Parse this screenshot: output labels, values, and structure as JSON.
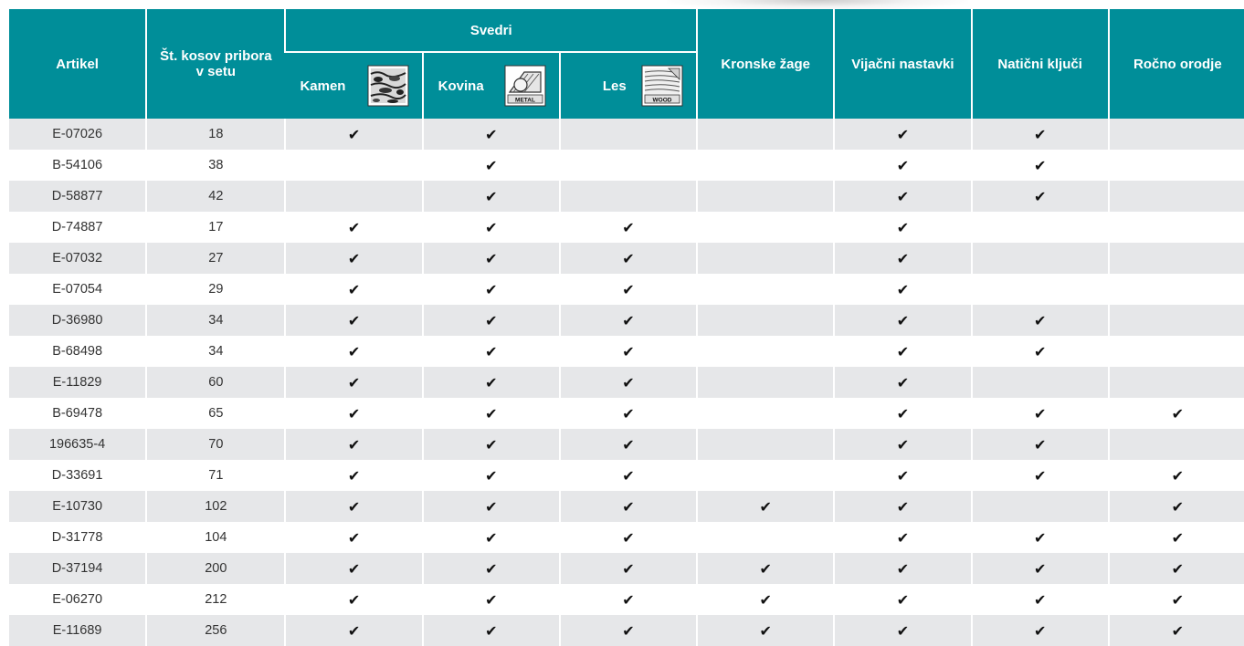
{
  "header": {
    "artikel": "Artikel",
    "pieces": "Št. kosov pribora v setu",
    "drills_group": "Svedri",
    "kamen": "Kamen",
    "kovina": "Kovina",
    "les": "Les",
    "kronske": "Kronske žage",
    "vijacni": "Vijačni nastavki",
    "naticni": "Natični ključi",
    "rocno": "Ročno orodje"
  },
  "icons": {
    "kamen": "stone-material-icon",
    "kovina": "metal-material-icon",
    "les": "wood-material-icon",
    "kovina_text": "METAL",
    "les_text": "WOOD"
  },
  "check_symbol": "✔",
  "colors": {
    "header_bg": "#008e99",
    "row_alt": "#e6e7e9",
    "header_text": "#ffffff"
  },
  "rows": [
    {
      "artikel": "E-07026",
      "pieces": "18",
      "checks": [
        1,
        1,
        0,
        0,
        1,
        1,
        0
      ]
    },
    {
      "artikel": "B-54106",
      "pieces": "38",
      "checks": [
        0,
        1,
        0,
        0,
        1,
        1,
        0
      ]
    },
    {
      "artikel": "D-58877",
      "pieces": "42",
      "checks": [
        0,
        1,
        0,
        0,
        1,
        1,
        0
      ]
    },
    {
      "artikel": "D-74887",
      "pieces": "17",
      "checks": [
        1,
        1,
        1,
        0,
        1,
        0,
        0
      ]
    },
    {
      "artikel": "E-07032",
      "pieces": "27",
      "checks": [
        1,
        1,
        1,
        0,
        1,
        0,
        0
      ]
    },
    {
      "artikel": "E-07054",
      "pieces": "29",
      "checks": [
        1,
        1,
        1,
        0,
        1,
        0,
        0
      ]
    },
    {
      "artikel": "D-36980",
      "pieces": "34",
      "checks": [
        1,
        1,
        1,
        0,
        1,
        1,
        0
      ]
    },
    {
      "artikel": "B-68498",
      "pieces": "34",
      "checks": [
        1,
        1,
        1,
        0,
        1,
        1,
        0
      ]
    },
    {
      "artikel": "E-11829",
      "pieces": "60",
      "checks": [
        1,
        1,
        1,
        0,
        1,
        0,
        0
      ]
    },
    {
      "artikel": "B-69478",
      "pieces": "65",
      "checks": [
        1,
        1,
        1,
        0,
        1,
        1,
        1
      ]
    },
    {
      "artikel": "196635-4",
      "pieces": "70",
      "checks": [
        1,
        1,
        1,
        0,
        1,
        1,
        0
      ]
    },
    {
      "artikel": "D-33691",
      "pieces": "71",
      "checks": [
        1,
        1,
        1,
        0,
        1,
        1,
        1
      ]
    },
    {
      "artikel": "E-10730",
      "pieces": "102",
      "checks": [
        1,
        1,
        1,
        1,
        1,
        0,
        1
      ]
    },
    {
      "artikel": "D-31778",
      "pieces": "104",
      "checks": [
        1,
        1,
        1,
        0,
        1,
        1,
        1
      ]
    },
    {
      "artikel": "D-37194",
      "pieces": "200",
      "checks": [
        1,
        1,
        1,
        1,
        1,
        1,
        1
      ]
    },
    {
      "artikel": "E-06270",
      "pieces": "212",
      "checks": [
        1,
        1,
        1,
        1,
        1,
        1,
        1
      ]
    },
    {
      "artikel": "E-11689",
      "pieces": "256",
      "checks": [
        1,
        1,
        1,
        1,
        1,
        1,
        1
      ]
    }
  ]
}
